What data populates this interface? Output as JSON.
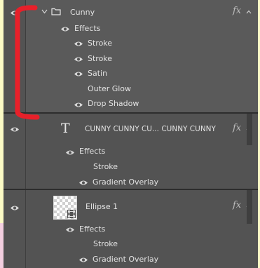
{
  "colors": {
    "panel": "#535353",
    "selected_row": "#5f5f5f",
    "annotation": "#e8202a",
    "page_bg": "#fbfac5"
  },
  "group": {
    "name": "Cunny",
    "fx_label": "fx",
    "effects_label": "Effects",
    "effects": [
      "Stroke",
      "Stroke",
      "Satin",
      "Outer Glow",
      "Drop Shadow"
    ],
    "effects_visible": [
      true,
      true,
      true,
      false,
      true
    ]
  },
  "text_layer": {
    "name": "CUNNY CUNNY CU... CUNNY CUNNY",
    "type_glyph": "T",
    "fx_label": "fx",
    "effects_label": "Effects",
    "effects": [
      "Stroke",
      "Gradient Overlay"
    ],
    "effects_visible": [
      false,
      true
    ]
  },
  "shape_layer": {
    "name": "Ellipse 1",
    "fx_label": "fx",
    "effects_label": "Effects",
    "effects": [
      "Stroke",
      "Gradient Overlay"
    ],
    "effects_visible": [
      false,
      true
    ]
  }
}
